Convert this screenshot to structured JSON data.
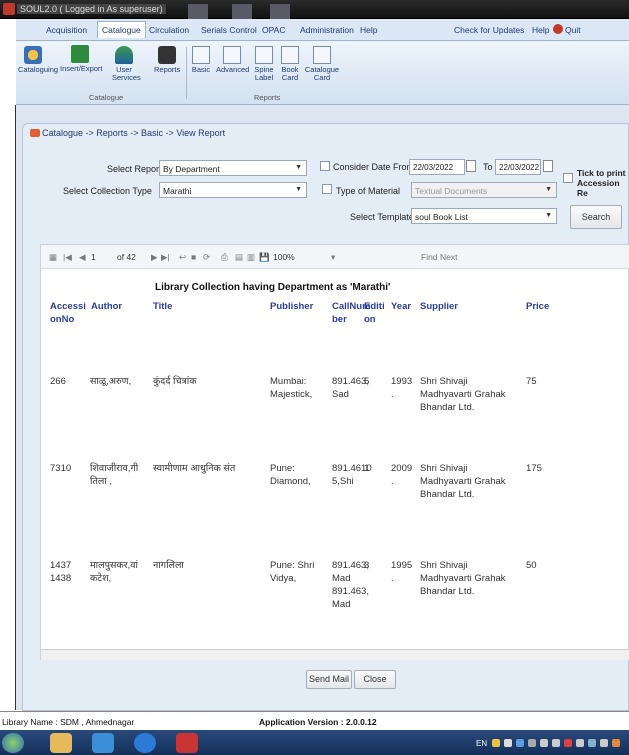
{
  "window": {
    "title": "SOUL2.0 ( Logged in As superuser)"
  },
  "menu": [
    "Acquisition",
    "Catalogue",
    "Circulation",
    "Serials Control",
    "OPAC",
    "Administration",
    "Help"
  ],
  "menu_right": {
    "updates": "Check for Updates",
    "help": "Help",
    "quit": "Quit"
  },
  "ribbon": {
    "buttons": [
      "Cataloguing",
      "Insert/Export",
      "User Services",
      "Reports",
      "Basic",
      "Advanced",
      "Spine Label",
      "Book Card",
      "Catalogue Card"
    ],
    "groups": {
      "catalogue": "Catalogue",
      "reports": "Reports"
    }
  },
  "breadcrumb": "Catalogue -> Reports -> Basic -> View Report",
  "form": {
    "select_report_label": "Select Report",
    "select_report_value": "By Department",
    "collection_type_label": "Select Collection Type",
    "collection_type_value": "Marathi",
    "consider_date_label": "Consider Date From",
    "date_from": "22/03/2022",
    "to_label": "To",
    "date_to": "22/03/2022",
    "material_label": "Type of Material",
    "material_value": "Textual Documents",
    "template_label": "Select Template",
    "template_value": "soul Book List",
    "search_button": "Search",
    "print_label_1": "Tick to print",
    "print_label_2": "Accession Re"
  },
  "viewer": {
    "page": "1",
    "page_of": "of 42",
    "zoom": "100%",
    "find": "Find",
    "next": "Next"
  },
  "report": {
    "title": "Library Collection having Department as 'Marathi'",
    "headers": [
      "Accessi onNo",
      "Author",
      "Title",
      "Publisher",
      "CallNum ber",
      "Editi on",
      "Year",
      "Supplier",
      "Price"
    ],
    "rows": [
      {
        "acc": "266",
        "author": "साळू,अरुण,",
        "title": "कुंदर्द चित्रांक",
        "publisher": "Mumbai: Majestick,",
        "call": "891.463, Sad",
        "ed": "5",
        "year": "1993 .",
        "supplier": "Shri Shivaji Madhyavarti Grahak Bhandar Ltd.",
        "price": "75"
      },
      {
        "acc": "7310",
        "author": "शिवाजीराव,गी तिला ,",
        "title": "स्वामीणाम आधुनिक संत",
        "publisher": "Pune: Diamond,",
        "call": "891.4610 5,Shi",
        "ed": "1",
        "year": "2009 .",
        "supplier": "Shri Shivaji Madhyavarti Grahak Bhandar Ltd.",
        "price": "175"
      },
      {
        "acc": "1437 1438",
        "author": "मालपुसकर,वां कटेश,",
        "title": "नागलिला",
        "publisher": "Pune: Shri Vidya,",
        "call": "891.463, Mad 891.463, Mad",
        "ed": "3",
        "year": "1995 .",
        "supplier": "Shri Shivaji Madhyavarti Grahak Bhandar Ltd.",
        "price": "50"
      }
    ]
  },
  "buttons": {
    "send": "Send Mail",
    "close": "Close"
  },
  "status": {
    "library": "Library Name : SDM , Ahmednagar",
    "version": "Application Version : 2.0.0.12"
  },
  "taskbar": {
    "lang": "EN"
  }
}
